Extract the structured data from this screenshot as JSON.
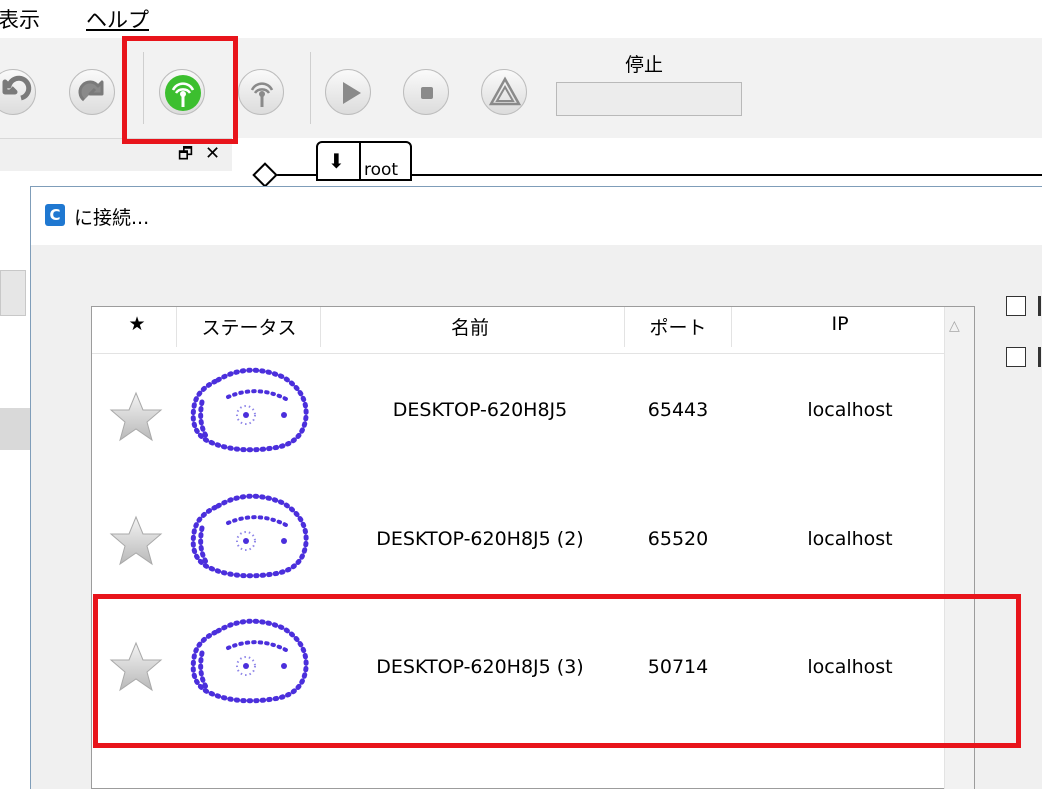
{
  "menu": {
    "view": "表示",
    "help": "ヘルプ"
  },
  "toolbar": {
    "status_label": "停止",
    "status_value": "",
    "buttons": [
      "undo-icon",
      "redo-icon",
      "connect-icon",
      "disconnect-icon",
      "play-icon",
      "stop-icon",
      "warning-icon"
    ],
    "connect_color": "#3cbf2f"
  },
  "dock": {
    "restore_glyph": "🗗",
    "close_glyph": "✕"
  },
  "graph": {
    "root_label": "root",
    "root_arrow": "⬇"
  },
  "dialog": {
    "badge": "C",
    "title": "に接続...",
    "table": {
      "headers": {
        "favorite": "★",
        "status": "ステータス",
        "name": "名前",
        "port": "ポート",
        "ip": "IP"
      },
      "rows": [
        {
          "name": "DESKTOP-620H8J5",
          "port": "65443",
          "ip": "localhost"
        },
        {
          "name": "DESKTOP-620H8J5 (2)",
          "port": "65520",
          "ip": "localhost"
        },
        {
          "name": "DESKTOP-620H8J5 (3)",
          "port": "50714",
          "ip": "localhost"
        }
      ]
    }
  },
  "colors": {
    "highlight": "#e8141b",
    "robot_dots": "#4b2fdc"
  }
}
